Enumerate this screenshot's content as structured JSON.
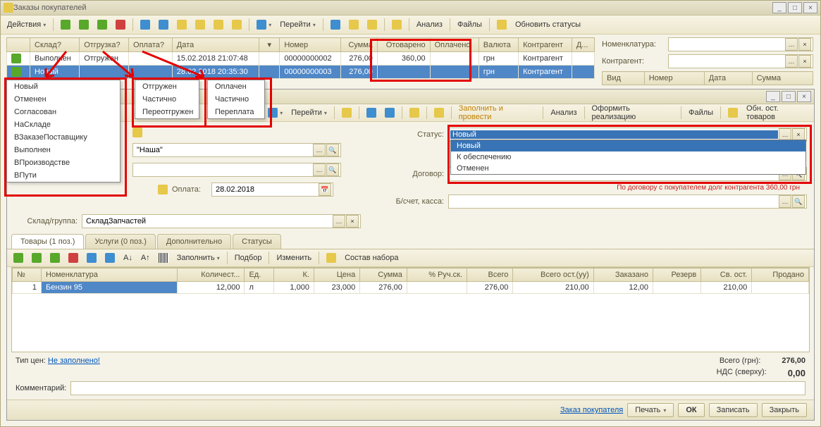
{
  "mainWindow": {
    "title": "Заказы покупателей",
    "actionsLabel": "Действия",
    "goToLabel": "Перейти",
    "analysisLabel": "Анализ",
    "filesLabel": "Файлы",
    "updateStatusLabel": "Обновить статусы"
  },
  "grid": {
    "cols": [
      "",
      "Склад?",
      "Отгрузка?",
      "Оплата?",
      "Дата",
      "",
      "Номер",
      "Сумма",
      "Отоварено",
      "Оплачено",
      "Валюта",
      "Контрагент",
      "Д..."
    ],
    "rows": [
      {
        "status": "done",
        "sklad": "Выполнен",
        "otgruzka": "Отгружен",
        "oplata": "",
        "date": "15.02.2018 21:07:48",
        "num": "00000000002",
        "sum": "276,00",
        "otovar": "360,00",
        "oplach": "",
        "val": "грн",
        "kontr": "Контрагент"
      },
      {
        "status": "new",
        "sklad": "Новый",
        "otgruzka": "",
        "oplata": "",
        "date": "28.02.2018 20:35:30",
        "num": "00000000003",
        "sum": "276,00",
        "otovar": "",
        "oplach": "",
        "val": "грн",
        "kontr": "Контрагент"
      }
    ]
  },
  "skladMenu": [
    "Новый",
    "Отменен",
    "Согласован",
    "НаСкладе",
    "ВЗаказеПоставщику",
    "Выполнен",
    "ВПроизводстве",
    "ВПути"
  ],
  "otgruzkaMenu": [
    "Отгружен",
    "Частично",
    "Переотгружен"
  ],
  "oplataMenu": [
    "Оплачен",
    "Частично",
    "Переплата"
  ],
  "filter": {
    "nomenLabel": "Номенклатура:",
    "kontrLabel": "Контрагент:",
    "cols": [
      "Вид",
      "Номер",
      "Дата",
      "Сумма"
    ]
  },
  "inner": {
    "toolbar": {
      "go": "Перейти",
      "fill": "Заполнить и провести",
      "analysis": "Анализ",
      "realize": "Оформить реализацию",
      "files": "Файлы",
      "updStock": "Обн. ост. товаров"
    },
    "fields": {
      "orgLabel": "\"Наша\"",
      "oplataLabel": "Оплата:",
      "oplataVal": "28.02.2018",
      "statusLabel": "Статус:",
      "statusVal": "Новый",
      "dogovorLabel": "Договор:",
      "accountLabel": "Б/счет, касса:",
      "skladLabel": "Склад/группа:",
      "skladVal": "СкладЗапчастей",
      "warnText": "По договору с покупателем долг контрагента 360,00 грн"
    },
    "statusOptions": [
      "Новый",
      "К обеспечению",
      "Отменен"
    ],
    "tabs": [
      "Товары (1 поз.)",
      "Услуги (0 поз.)",
      "Дополнительно",
      "Статусы"
    ],
    "innerToolbar": {
      "fill": "Заполнить",
      "select": "Подбор",
      "change": "Изменить",
      "set": "Состав набора"
    },
    "itemCols": [
      "№",
      "Номенклатура",
      "Количест...",
      "Ед.",
      "К.",
      "Цена",
      "Сумма",
      "% Руч.ск.",
      "Всего",
      "Всего ост.(уу)",
      "Заказано",
      "Резерв",
      "Св. ост.",
      "Продано"
    ],
    "itemRow": {
      "n": "1",
      "name": "Бензин 95",
      "qty": "12,000",
      "unit": "л",
      "k": "1,000",
      "price": "23,000",
      "sum": "276,00",
      "disc": "",
      "total": "276,00",
      "ost": "210,00",
      "ordered": "12,00",
      "reserve": "",
      "free": "210,00",
      "sold": ""
    },
    "priceTypeLabel": "Тип цен:",
    "priceTypeVal": "Не заполнено!",
    "totalLabel": "Всего (грн):",
    "totalVal": "276,00",
    "vatLabel": "НДС (сверху):",
    "vatVal": "0,00",
    "commentLabel": "Комментарий:"
  },
  "bottom": {
    "orderLink": "Заказ покупателя",
    "print": "Печать",
    "ok": "ОК",
    "save": "Записать",
    "close": "Закрыть"
  }
}
